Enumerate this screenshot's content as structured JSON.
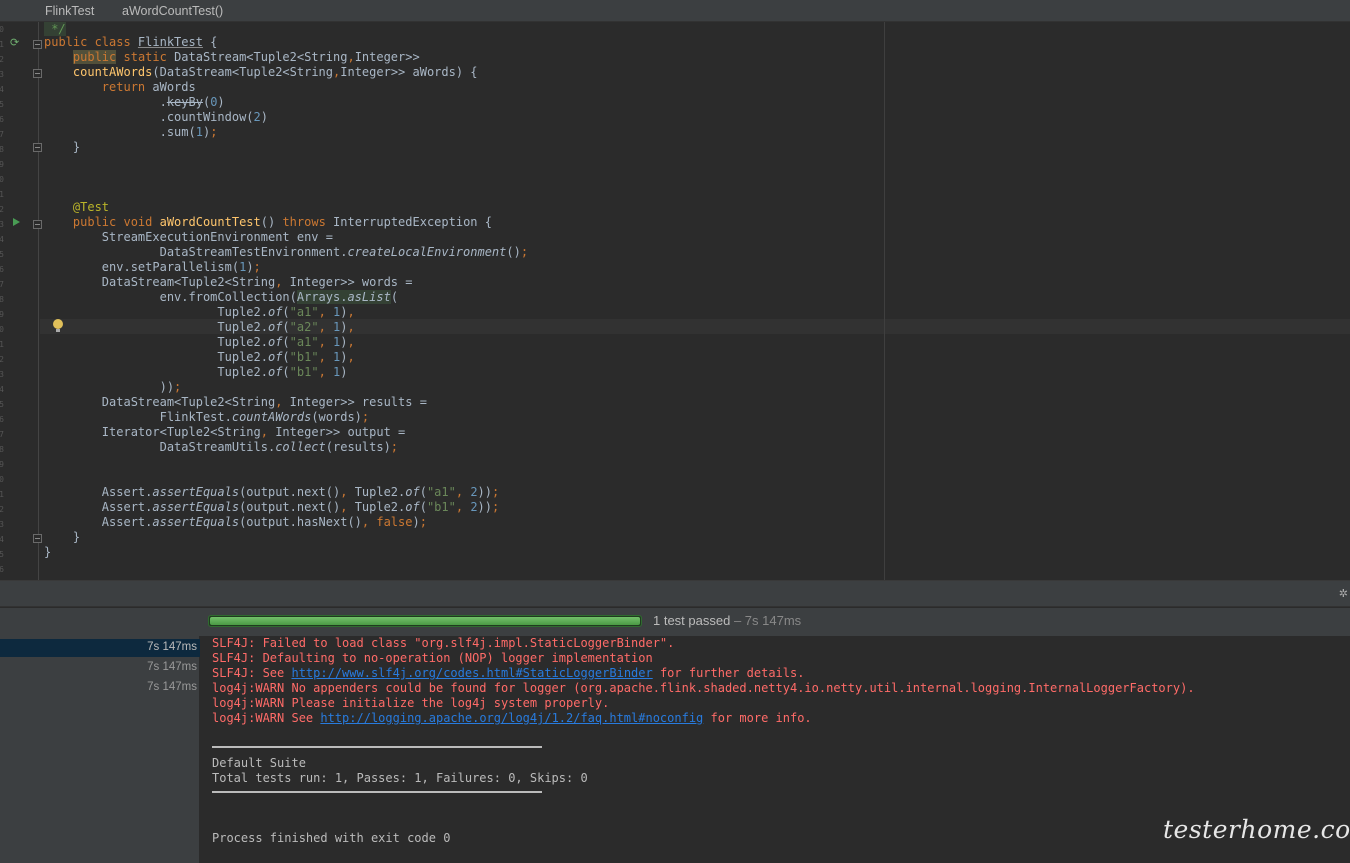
{
  "breadcrumb": {
    "class_name": "FlinkTest",
    "method_name": "aWordCountTest()"
  },
  "editor": {
    "line_numbers": [
      "0",
      "1",
      "2",
      "3",
      "4",
      "5",
      "6",
      "7",
      "8",
      "9",
      "0",
      "1",
      "2",
      "3",
      "4",
      "5",
      "6",
      "7",
      "8",
      "9",
      "0",
      "1",
      "2",
      "3",
      "4",
      "5",
      "6",
      "7",
      "8",
      "9",
      "0",
      "1",
      "2",
      "3",
      "4",
      "5",
      "6",
      "7"
    ],
    "code": {
      "l00": " */",
      "l01_kw": "public class ",
      "l01_name": "FlinkTest",
      "l01_rest": " {",
      "l02_public": "public",
      "l02_static": " static ",
      "l02_type": "DataStream<Tuple2<String",
      "l02_comma": ",",
      "l02_int": "Integer>>",
      "l03_fn": "countAWords",
      "l03_a": "(DataStream<Tuple2<String",
      "l03_comma": ",",
      "l03_b": "Integer>> aWords) {",
      "l04_kw": "return ",
      "l04_rest": "aWords",
      "l05_dot": ".",
      "l05_keyby": "keyBy",
      "l05_open": "(",
      "l05_num": "0",
      "l05_close": ")",
      "l06_a": ".countWindow(",
      "l06_num": "2",
      "l06_b": ")",
      "l07_a": ".sum(",
      "l07_num": "1",
      "l07_b": ")",
      "l07_semi": ";",
      "l08": "}",
      "l12": "@Test",
      "l13_kw1": "public void ",
      "l13_fn": "aWordCountTest",
      "l13_mid": "() ",
      "l13_kw2": "throws ",
      "l13_rest": "InterruptedException {",
      "l14": "StreamExecutionEnvironment env =",
      "l15_a": "DataStreamTestEnvironment.",
      "l15_it": "createLocalEnvironment",
      "l15_b": "()",
      "l15_semi": ";",
      "l16_a": "env.setParallelism(",
      "l16_num": "1",
      "l16_b": ")",
      "l16_semi": ";",
      "l17_a": "DataStream<Tuple2<String",
      "l17_comma": ",",
      "l17_b": " Integer>> words =",
      "l18_a": "env.fromCollection(",
      "l18_arr": "Arrays.",
      "l18_aslist": "asList",
      "l18_b": "(",
      "t_pre": "Tuple2.",
      "t_of": "of",
      "t_open": "(",
      "t1_str": "\"a1\"",
      "t2_str": "\"a2\"",
      "t3_str": "\"a1\"",
      "t4_str": "\"b1\"",
      "t5_str": "\"b1\"",
      "t_comma": ", ",
      "t_num": "1",
      "t_close": ")",
      "t_end": ",",
      "l24_a": "))",
      "l24_semi": ";",
      "l25_a": "DataStream<Tuple2<String",
      "l25_comma": ",",
      "l25_b": " Integer>> results =",
      "l26_a": "FlinkTest.",
      "l26_it": "countAWords",
      "l26_b": "(words)",
      "l26_semi": ";",
      "l27_a": "Iterator<Tuple2<String",
      "l27_comma": ",",
      "l27_b": " Integer>> output =",
      "l28_a": "DataStreamUtils.",
      "l28_it": "collect",
      "l28_b": "(results)",
      "l28_semi": ";",
      "as_pre": "Assert.",
      "as_eq": "assertEquals",
      "l31_a": "(output.next()",
      "l31_comma": ", ",
      "l31_b": "Tuple2.",
      "l31_of": "of",
      "l31_c": "(",
      "l31_str": "\"a1\"",
      "l31_comma2": ", ",
      "l31_num": "2",
      "l31_d": "))",
      "l31_semi": ";",
      "l32_a": "(output.next()",
      "l32_comma": ", ",
      "l32_b": "Tuple2.",
      "l32_of": "of",
      "l32_c": "(",
      "l32_str": "\"b1\"",
      "l32_comma2": ", ",
      "l32_num": "2",
      "l32_d": "))",
      "l32_semi": ";",
      "l33_a": "(output.hasNext()",
      "l33_comma": ", ",
      "l33_false": "false",
      "l33_b": ")",
      "l33_semi": ";",
      "l34": "}",
      "l35": "}"
    }
  },
  "test_runner": {
    "progress": 1.0,
    "status_main": "1 test passed",
    "status_time": " – 7s 147ms",
    "tree_times": [
      "7s 147ms",
      "7s 147ms",
      "7s 147ms"
    ]
  },
  "console": {
    "slf1": "SLF4J: Failed to load class \"org.slf4j.impl.StaticLoggerBinder\".",
    "slf2": "SLF4J: Defaulting to no-operation (NOP) logger implementation",
    "slf3_a": "SLF4J: See ",
    "slf3_link": "http://www.slf4j.org/codes.html#StaticLoggerBinder",
    "slf3_b": " for further details.",
    "log1": "log4j:WARN No appenders could be found for logger (org.apache.flink.shaded.netty4.io.netty.util.internal.logging.InternalLoggerFactory).",
    "log2": "log4j:WARN Please initialize the log4j system properly.",
    "log3_a": "log4j:WARN See ",
    "log3_link": "http://logging.apache.org/log4j/1.2/faq.html#noconfig",
    "log3_b": " for more info.",
    "suite": "Default Suite",
    "summary": "Total tests run: 1, Passes: 1, Failures: 0, Skips: 0",
    "exit": "Process finished with exit code 0"
  },
  "watermark": "testerhome.com",
  "colors": {
    "keyword": "#cc7832",
    "function": "#ffc66d",
    "string": "#6a8759",
    "number": "#6897bb",
    "annotation": "#bbb529",
    "error": "#ff6b68",
    "link": "#287bde",
    "passed": "#4b9a45"
  }
}
